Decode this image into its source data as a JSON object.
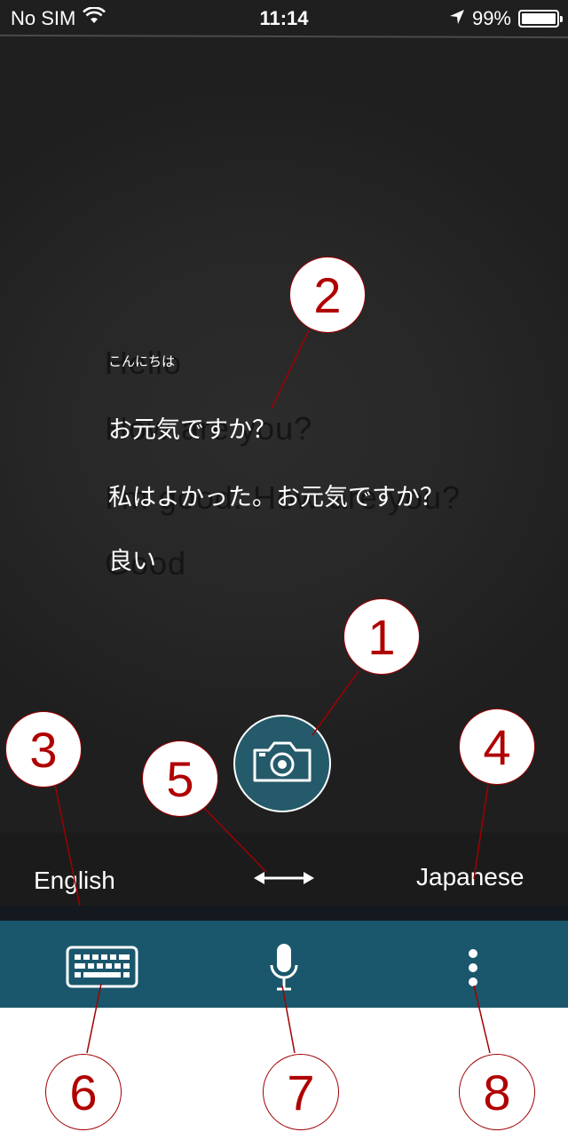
{
  "status_bar": {
    "carrier": "No SIM",
    "time": "11:14",
    "battery_percent": "99%",
    "battery_level": 0.99,
    "icons": [
      "wifi-icon",
      "location-arrow-icon",
      "battery-icon"
    ]
  },
  "camera_view": {
    "source_lines": [
      "Hello",
      "How are you?",
      "I'm good. How are you?",
      "Good"
    ],
    "translated_lines": [
      "こんにちは",
      "お元気ですか？",
      "私はよかった。お元気ですか？",
      "良い"
    ]
  },
  "language_bar": {
    "source_language": "English",
    "target_language": "Japanese",
    "swap_icon": "swap-arrows-icon"
  },
  "shutter": {
    "icon": "camera-icon"
  },
  "toolbar": {
    "icons": [
      "keyboard-icon",
      "microphone-icon",
      "more-vertical-icon"
    ]
  },
  "callouts": [
    "1",
    "2",
    "3",
    "4",
    "5",
    "6",
    "7",
    "8"
  ],
  "colors": {
    "toolbar": "#1a576c",
    "shutter": "#245a6a",
    "callout": "#b00000"
  }
}
